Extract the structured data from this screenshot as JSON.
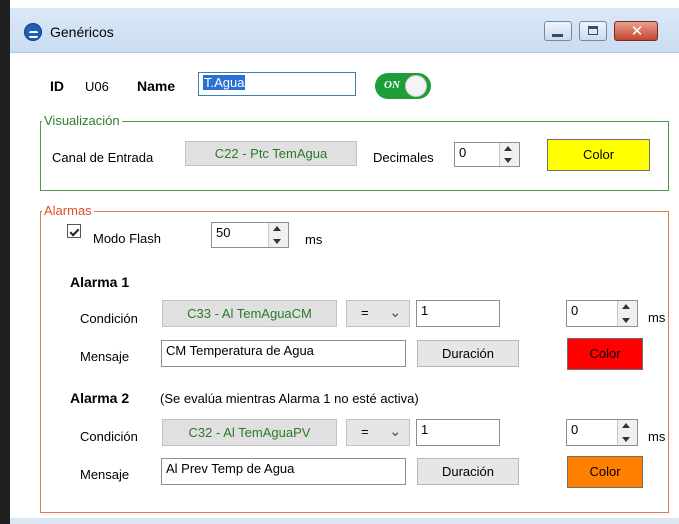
{
  "window": {
    "title": "Genéricos",
    "buttons": [
      "minimize-icon",
      "maximize-icon",
      "close-icon"
    ],
    "close_glyph": "✕"
  },
  "header": {
    "id_label": "ID",
    "id_value": "U06",
    "name_label": "Name",
    "name_value": "T.Agua",
    "toggle_label": "ON",
    "toggle_on": true
  },
  "visualizacion": {
    "legend": "Visualización",
    "canal_label": "Canal de Entrada",
    "canal_value": "C22 - Ptc TemAgua",
    "decimales_label": "Decimales",
    "decimales_value": "0",
    "color_label": "Color",
    "color_hex": "#ffff00"
  },
  "alarmas": {
    "legend": "Alarmas",
    "modo_flash_label": "Modo Flash",
    "modo_flash_checked": true,
    "modo_flash_value": "50",
    "modo_flash_unit": "ms",
    "alarma1": {
      "title": "Alarma 1",
      "condicion_label": "Condición",
      "condicion_channel": "C33 - Al TemAguaCM",
      "operator": "=",
      "threshold": "1",
      "delay_value": "0",
      "delay_unit": "ms",
      "mensaje_label": "Mensaje",
      "mensaje_value": "CM Temperatura de Agua",
      "duracion_label": "Duración",
      "color_label": "Color",
      "color_hex": "#ff0000"
    },
    "alarma2": {
      "title": "Alarma 2",
      "note": "(Se evalúa mientras Alarma 1 no esté activa)",
      "condicion_label": "Condición",
      "condicion_channel": "C32 - Al TemAguaPV",
      "operator": "=",
      "threshold": "1",
      "delay_value": "0",
      "delay_unit": "ms",
      "mensaje_label": "Mensaje",
      "mensaje_value": "Al Prev Temp de Agua",
      "duracion_label": "Duración",
      "color_label": "Color",
      "color_hex": "#ff8000"
    }
  }
}
